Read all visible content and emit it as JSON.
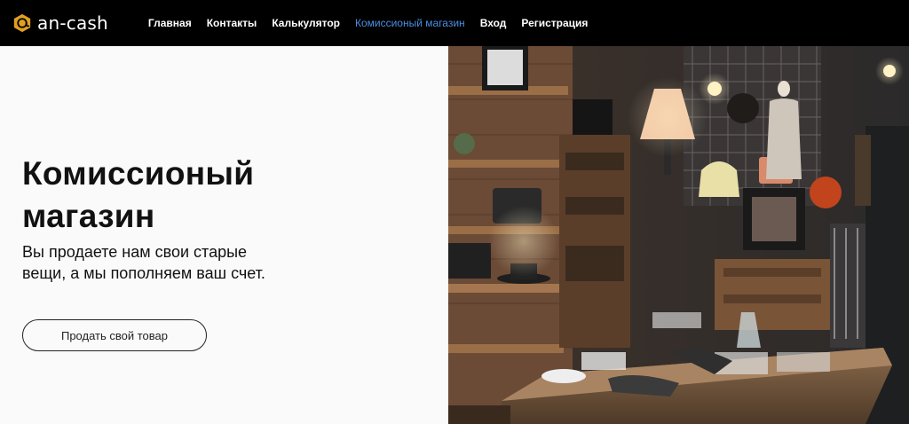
{
  "brand": {
    "name": "an-cash",
    "logo_icon": "at-sign-hexagon-icon",
    "accent": "#e0a020"
  },
  "nav": {
    "items": [
      {
        "label": "Главная",
        "active": false
      },
      {
        "label": "Контакты",
        "active": false
      },
      {
        "label": "Калькулятор",
        "active": false
      },
      {
        "label": "Комиссионый магазин",
        "active": true
      },
      {
        "label": "Вход",
        "active": false
      },
      {
        "label": "Регистрация",
        "active": false
      }
    ],
    "active_color": "#4a8fe3"
  },
  "hero": {
    "title_line1": "Комиссионый",
    "title_line2": "магазин",
    "subtitle_line1": "Вы продаете нам свои старые",
    "subtitle_line2": "вещи, а мы пополняем ваш счет.",
    "button_label": "Продать свой товар"
  }
}
